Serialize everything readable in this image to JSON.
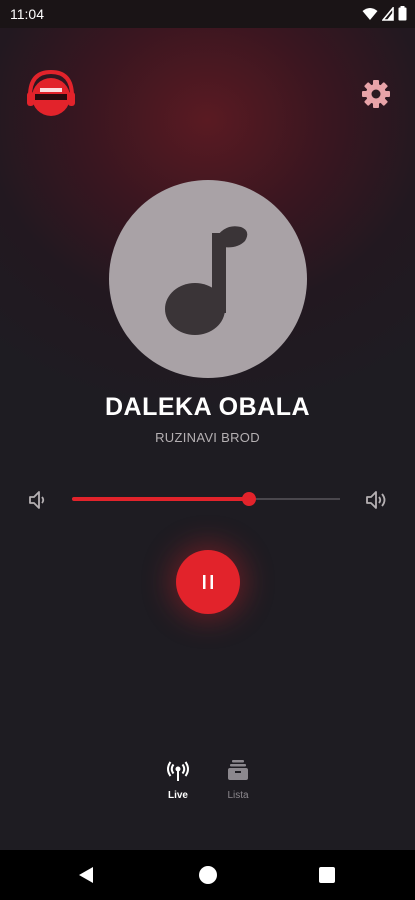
{
  "status_bar": {
    "time": "11:04",
    "icons": [
      "wifi-icon",
      "signal-icon",
      "battery-icon"
    ]
  },
  "header": {
    "logo_icon": "radio-nacional-logo-icon",
    "settings_icon": "gear-icon"
  },
  "now_playing": {
    "artwork_icon": "music-note-icon",
    "title": "DALEKA OBALA",
    "artist": "RUZINAVI BROD"
  },
  "volume": {
    "level": 0.66,
    "low_icon": "volume-low-icon",
    "high_icon": "volume-high-icon"
  },
  "controls": {
    "state": "playing",
    "pause_icon": "pause-icon"
  },
  "bottom_nav": {
    "items": [
      {
        "label": "Live",
        "icon": "broadcast-icon",
        "active": true
      },
      {
        "label": "Lista",
        "icon": "playlist-icon",
        "active": false
      }
    ]
  },
  "colors": {
    "accent": "#e2232b",
    "background": "#1e1c22"
  }
}
